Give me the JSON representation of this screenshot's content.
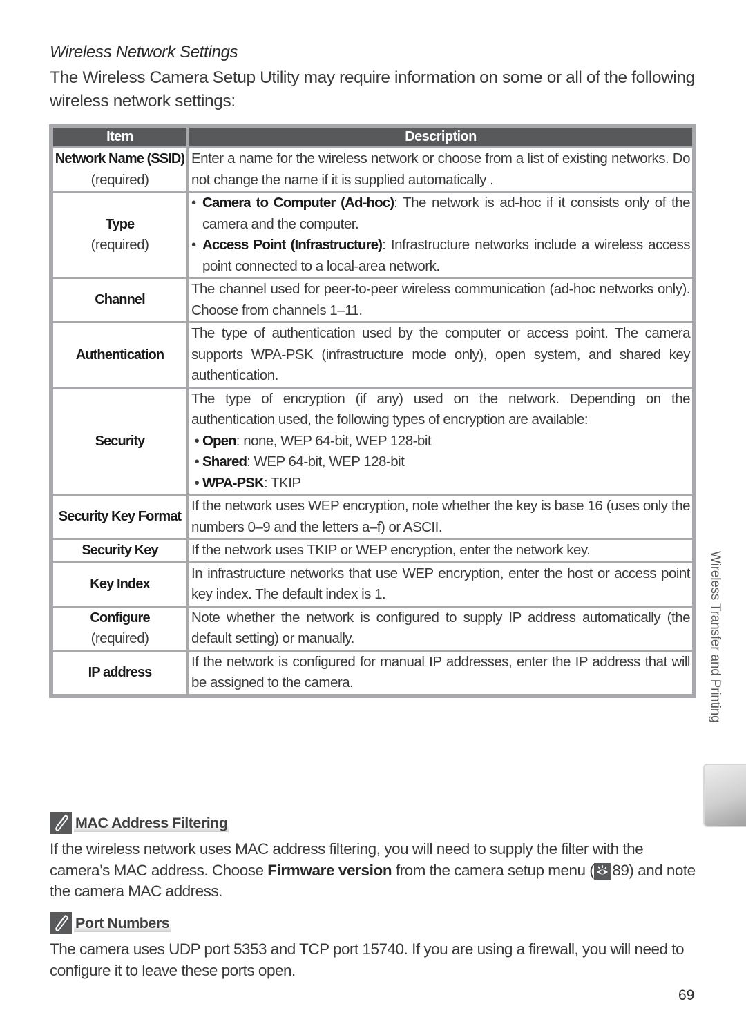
{
  "heading": "Wireless Network Settings",
  "intro": "The Wireless Camera Setup Utility may require information on some or all of the following wireless network settings:",
  "table": {
    "headers": {
      "item": "Item",
      "description": "Description"
    },
    "rows": [
      {
        "item": "Network Name (SSID)",
        "required": "(required)",
        "description": "Enter a name for the wireless network or choose from a list of existing networks.  Do not change the name if it is supplied automatically ."
      },
      {
        "item": "Type",
        "required": "(required)",
        "bullets": [
          {
            "term": "Camera to Computer (Ad-hoc)",
            "text": ": The network is ad-hoc if it consists only of the camera and the computer."
          },
          {
            "term": "Access Point (Infrastructure)",
            "text": ": Infrastructure networks include a wireless access point connected to a local-area network."
          }
        ]
      },
      {
        "item": "Channel",
        "description": "The channel used for peer-to-peer wireless communication (ad-hoc networks only).  Choose from channels 1–11."
      },
      {
        "item": "Authentication",
        "description": "The type of authentication used by the computer or access point.  The camera supports WPA-PSK (infrastructure mode only), open system, and shared key authentication."
      },
      {
        "item": "Security",
        "description": "The type of encryption (if any) used on the network.  Depending on the authentication used, the following types of encryption are available:",
        "bullets": [
          {
            "term": "Open",
            "text": ": none, WEP 64-bit, WEP 128-bit"
          },
          {
            "term": "Shared",
            "text": ": WEP 64-bit, WEP 128-bit"
          },
          {
            "term": "WPA-PSK",
            "text": ": TKIP"
          }
        ]
      },
      {
        "item": "Security Key Format",
        "description": "If the network uses WEP encryption, note whether the key is base 16 (uses only the numbers 0–9 and the letters a–f) or ASCII."
      },
      {
        "item": "Security Key",
        "description": "If the network uses TKIP or WEP encryption, enter the network key."
      },
      {
        "item": "Key Index",
        "description": "In infrastructure networks that use WEP encryption, enter the host or access point key index.  The default index is 1."
      },
      {
        "item": "Configure",
        "required": "(required)",
        "description": "Note whether the network is configured to supply IP address automatically (the default setting) or manually."
      },
      {
        "item": "IP address",
        "description": "If the network is configured for manual IP addresses, enter the IP address that will be assigned to the camera."
      }
    ]
  },
  "side_tab": {
    "label": "Wireless Transfer and Printing"
  },
  "notes": [
    {
      "title": "MAC Address Filtering",
      "icon": "pencil-note-icon",
      "body_before": "If the wireless network uses MAC address filtering, you will need to supply the filter with the camera’s MAC address.  Choose ",
      "body_bold": "Firmware version",
      "body_mid": " from the camera setup menu (",
      "ref_icon": "setup-menu-icon",
      "ref_page": "89",
      "body_after": ") and note the camera MAC address."
    },
    {
      "title": "Port Numbers",
      "icon": "pencil-note-icon",
      "body": "The camera uses UDP port 5353 and TCP port 15740.  If you are using a firewall, you will need to configure it to leave these ports open."
    }
  ],
  "page_number": "69",
  "colors": {
    "table_header_bg": "#58595b",
    "table_frame": "#a7a9ac",
    "text": "#3a3a3a"
  }
}
